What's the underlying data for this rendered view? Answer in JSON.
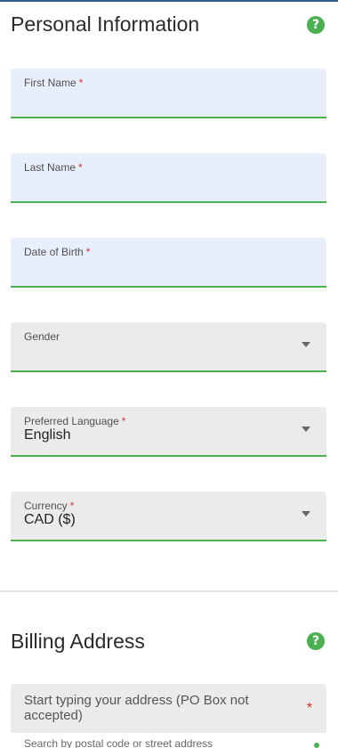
{
  "personal": {
    "title": "Personal Information",
    "help_icon": "?",
    "fields": [
      {
        "label": "First Name",
        "required": "*",
        "value": "",
        "kind": "text"
      },
      {
        "label": "Last Name",
        "required": "*",
        "value": "",
        "kind": "text"
      },
      {
        "label": "Date of Birth",
        "required": "*",
        "value": "",
        "kind": "text"
      },
      {
        "label": "Gender",
        "required": "",
        "value": "",
        "kind": "select"
      },
      {
        "label": "Preferred Language",
        "required": "*",
        "value": "English",
        "kind": "select"
      },
      {
        "label": "Currency",
        "required": "*",
        "value": "CAD ($)",
        "kind": "select"
      }
    ]
  },
  "billing": {
    "title": "Billing Address",
    "help_icon": "?",
    "address_placeholder": "Start typing your address (PO Box not accepted)",
    "address_required": "*",
    "hint": "Search by postal code or street address"
  },
  "colors": {
    "accent_green": "#4caf50",
    "required_red": "#d32f2f",
    "text_field_bg": "#e8effc",
    "select_field_bg": "#ebebeb"
  },
  "icons": {
    "help": "help-circle-icon",
    "dropdown": "chevron-down-icon"
  }
}
